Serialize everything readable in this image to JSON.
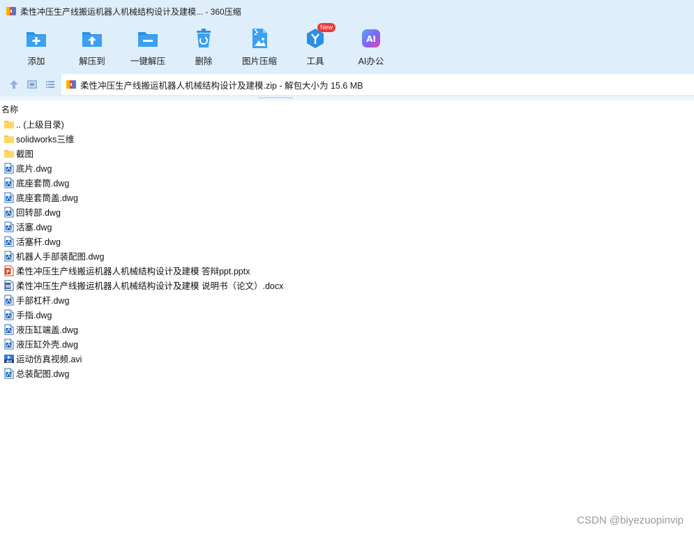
{
  "window": {
    "title": "柔性冲压生产线搬运机器人机械结构设计及建模... - 360压缩",
    "app_icon": "zip-archive-icon"
  },
  "toolbar": {
    "items": [
      {
        "label": "添加",
        "icon": "add-folder-icon"
      },
      {
        "label": "解压到",
        "icon": "extract-to-icon"
      },
      {
        "label": "一键解压",
        "icon": "one-click-extract-icon"
      },
      {
        "label": "删除",
        "icon": "trash-icon"
      },
      {
        "label": "图片压缩",
        "icon": "image-compress-icon"
      },
      {
        "label": "工具",
        "icon": "tools-icon",
        "badge": "New"
      },
      {
        "label": "AI办公",
        "icon": "ai-office-icon",
        "icon_text": "AI"
      }
    ]
  },
  "address": {
    "text": "柔性冲压生产线搬运机器人机械结构设计及建模.zip - 解包大小为 15.6 MB"
  },
  "list": {
    "column_name": "名称",
    "files": [
      {
        "name": ".. (上级目录)",
        "type": "folder"
      },
      {
        "name": "solidworks三维",
        "type": "folder"
      },
      {
        "name": "截图",
        "type": "folder"
      },
      {
        "name": "底片.dwg",
        "type": "dwg"
      },
      {
        "name": "底座套筒.dwg",
        "type": "dwg"
      },
      {
        "name": "底座套筒盖.dwg",
        "type": "dwg"
      },
      {
        "name": "回转部.dwg",
        "type": "dwg"
      },
      {
        "name": "活塞.dwg",
        "type": "dwg"
      },
      {
        "name": "活塞杆.dwg",
        "type": "dwg"
      },
      {
        "name": "机器人手部装配图.dwg",
        "type": "dwg"
      },
      {
        "name": "柔性冲压生产线搬运机器人机械结构设计及建模 答辩ppt.pptx",
        "type": "pptx"
      },
      {
        "name": "柔性冲压生产线搬运机器人机械结构设计及建模 说明书（论文）.docx",
        "type": "docx"
      },
      {
        "name": "手部杠杆.dwg",
        "type": "dwg"
      },
      {
        "name": "手指.dwg",
        "type": "dwg"
      },
      {
        "name": "液压缸端盖.dwg",
        "type": "dwg"
      },
      {
        "name": "液压缸外壳.dwg",
        "type": "dwg"
      },
      {
        "name": "运动仿真视频.avi",
        "type": "avi"
      },
      {
        "name": "总装配图.dwg",
        "type": "dwg"
      }
    ]
  },
  "watermark": "CSDN @biyezuopinvip",
  "colors": {
    "toolbar_bg": "#dfeefb",
    "icon_blue": "#2b8fe6",
    "folder_yellow": "#ffd766",
    "badge_red": "#f0373a"
  }
}
